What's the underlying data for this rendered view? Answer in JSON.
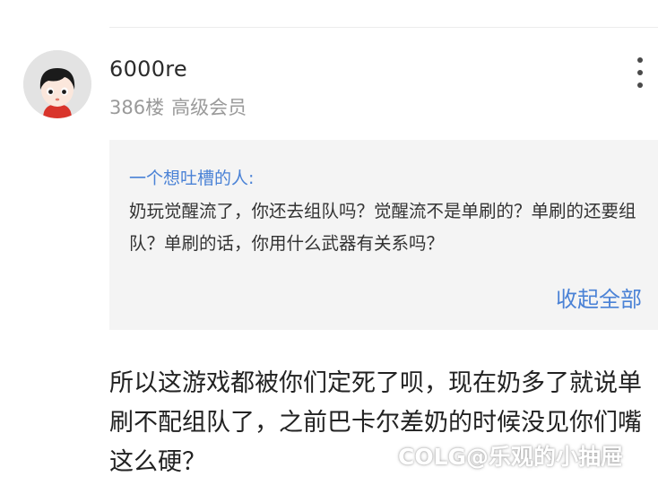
{
  "post": {
    "username": "6000re",
    "floor": "386楼",
    "rank": "高级会员",
    "more_icon": "more-vertical-icon",
    "quote": {
      "author": "一个想吐槽的人:",
      "body": "奶玩觉醒流了，你还去组队吗？觉醒流不是单刷的？单刷的还要组队？单刷的话，你用什么武器有关系吗？",
      "collapse_label": "收起全部"
    },
    "content": "所以这游戏都被你们定死了呗，现在奶多了就说单刷不配组队了，之前巴卡尔差奶的时候没见你们嘴这么硬？"
  },
  "watermark": "COLG@乐观的小抽屉",
  "colors": {
    "link_blue": "#4a82d6",
    "quote_bg": "#f4f4f4",
    "meta_gray": "#9a9a9a"
  }
}
